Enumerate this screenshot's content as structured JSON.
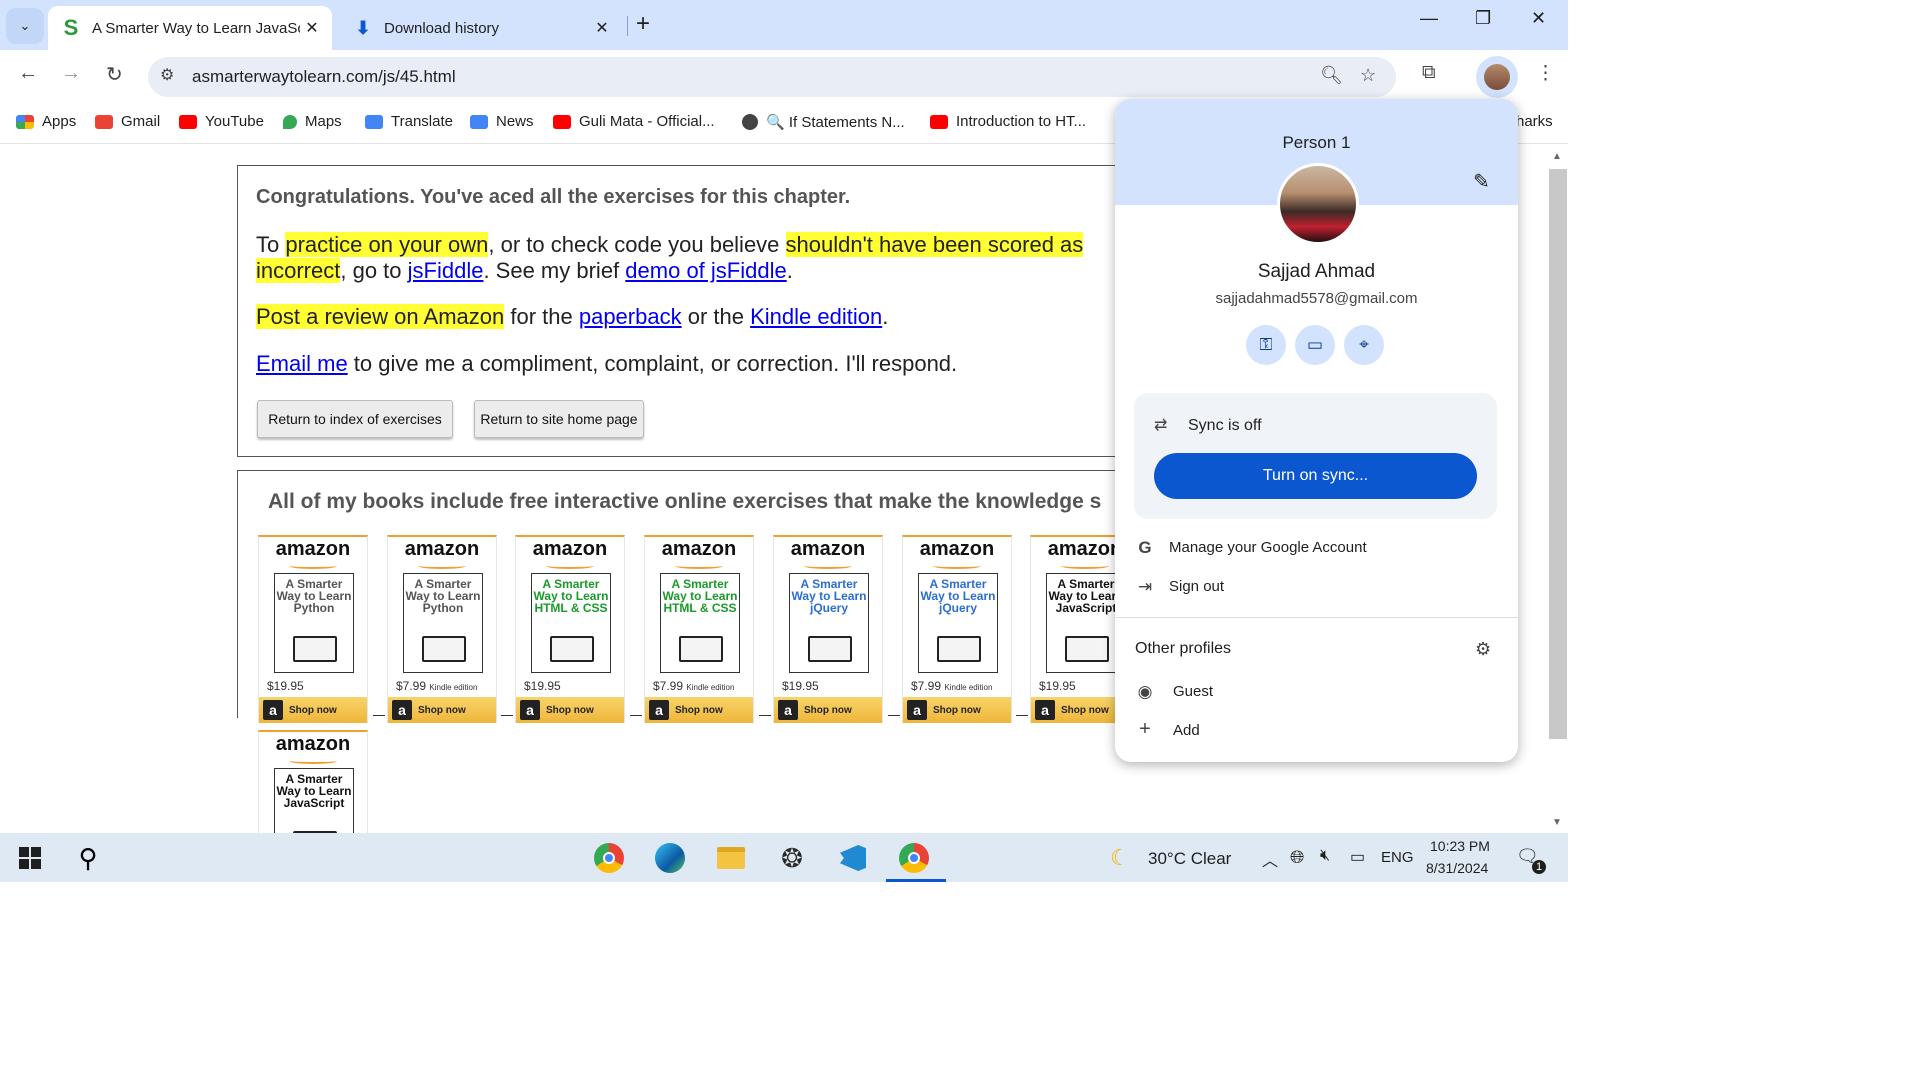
{
  "browser": {
    "tabs": [
      {
        "title": "A Smarter Way to Learn JavaScr",
        "favicon": "S",
        "active": true
      },
      {
        "title": "Download history",
        "favicon": "download-icon",
        "active": false
      }
    ],
    "url": "asmarterwaytolearn.com/js/45.html",
    "bookmarks": [
      {
        "label": "Apps",
        "icon": "apps-grid-icon",
        "color": "#4285f4"
      },
      {
        "label": "Gmail",
        "icon": "gmail-icon",
        "color": "#ea4335"
      },
      {
        "label": "YouTube",
        "icon": "youtube-icon",
        "color": "#ff0000"
      },
      {
        "label": "Maps",
        "icon": "maps-icon",
        "color": "#34a853"
      },
      {
        "label": "Translate",
        "icon": "translate-icon",
        "color": "#4285f4"
      },
      {
        "label": "News",
        "icon": "news-icon",
        "color": "#4285f4"
      },
      {
        "label": "Guli Mata - Official...",
        "icon": "youtube-icon",
        "color": "#ff0000"
      },
      {
        "label": "🔍 If Statements N...",
        "icon": "globe-icon",
        "color": "#444444"
      },
      {
        "label": "Introduction to HT...",
        "icon": "youtube-icon",
        "color": "#ff0000"
      },
      {
        "label": "harks",
        "icon": "",
        "color": ""
      }
    ]
  },
  "page": {
    "congrats": "Congratulations. You've aced all the exercises for this chapter.",
    "p1": {
      "a": "To ",
      "hl1": "practice on your own",
      "b": ", or to check code you believe ",
      "hl2a": "shouldn't have been scored as",
      "hl2b": "incorrect",
      "c": ", go to ",
      "link1": "jsFiddle",
      "d": ". See my brief ",
      "link2": "demo of jsFiddle",
      "e": "."
    },
    "p2": {
      "hl": "Post a review on Amazon",
      "a": " for the ",
      "link1": "paperback",
      "b": " or the ",
      "link2": "Kindle edition",
      "c": "."
    },
    "p3": {
      "link": "Email me",
      "a": " to give me a compliment, complaint, or correction. I'll respond."
    },
    "buttons": {
      "index": "Return to index of exercises",
      "home": "Return to site home page"
    },
    "books_heading": "All of my books include free interactive online exercises that make the knowledge s",
    "books": [
      {
        "title": "A Smarter Way to Learn Python",
        "price": "$19.95",
        "edition": "",
        "color": "#555555"
      },
      {
        "title": "A Smarter Way to Learn Python",
        "price": "$7.99",
        "edition": "Kindle edition",
        "color": "#555555"
      },
      {
        "title": "A Smarter Way to Learn HTML & CSS",
        "price": "$19.95",
        "edition": "",
        "color": "#1a9a2a"
      },
      {
        "title": "A Smarter Way to Learn HTML & CSS",
        "price": "$7.99",
        "edition": "Kindle edition",
        "color": "#1a9a2a"
      },
      {
        "title": "A Smarter Way to Learn jQuery",
        "price": "$19.95",
        "edition": "",
        "color": "#2a6fd0"
      },
      {
        "title": "A Smarter Way to Learn jQuery",
        "price": "$7.99",
        "edition": "Kindle edition",
        "color": "#2a6fd0"
      },
      {
        "title": "A Smarter Way to Learn JavaScript",
        "price": "$19.95",
        "edition": "",
        "color": "#111111"
      },
      {
        "title": "A Smarter Way to Learn JavaScript",
        "price": "",
        "edition": "",
        "color": "#111111"
      }
    ],
    "amazon_label": "amazon",
    "shop_now": "Shop now"
  },
  "profile": {
    "header_name": "Person 1",
    "name": "Sajjad Ahmad",
    "email": "sajjadahmad5578@gmail.com",
    "sync_status": "Sync is off",
    "sync_button": "Turn on sync...",
    "manage_account": "Manage your Google Account",
    "sign_out": "Sign out",
    "other_profiles": "Other profiles",
    "guest": "Guest",
    "add": "Add"
  },
  "taskbar": {
    "weather": "30°C  Clear",
    "lang": "ENG",
    "time": "10:23 PM",
    "date": "8/31/2024",
    "notifications": "1"
  }
}
